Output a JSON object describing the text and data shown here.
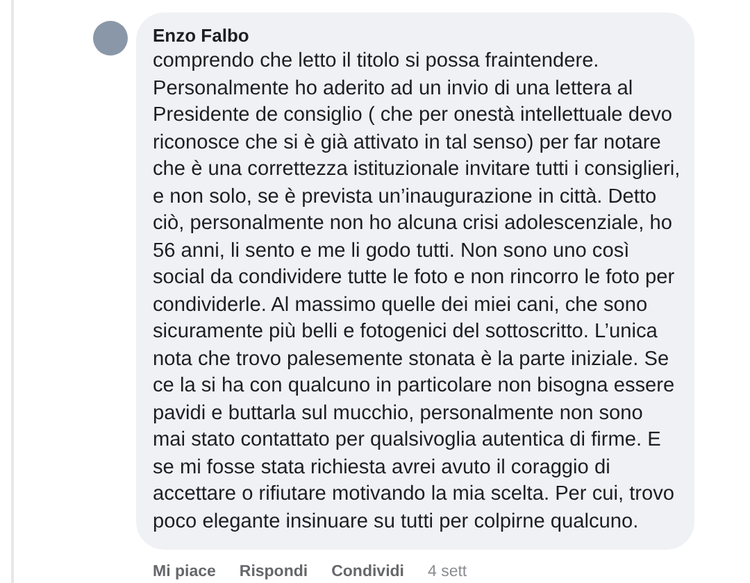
{
  "comment": {
    "author": "Enzo Falbo",
    "text": "comprendo che letto il titolo si possa fraintendere. Personalmente ho aderito ad un invio di una lettera al Presidente de consiglio ( che per onestà intellettuale devo riconosce che si è già attivato in tal senso) per far notare che è una correttezza istituzionale invitare tutti i consiglieri, e non solo, se è prevista un’inaugurazione in città. Detto ciò, personalmente non ho alcuna crisi adolescenziale, ho 56 anni, li sento e me li godo tutti. Non sono uno così social da condividere tutte le foto e non rincorro le foto per condividerle. Al massimo quelle dei miei cani, che sono sicuramente più belli e fotogenici del sottoscritto. L’unica nota che trovo palesemente stonata è la parte iniziale. Se ce la si ha con qualcuno in particolare non bisogna essere pavidi e buttarla sul mucchio, personalmente non sono mai stato contattato per qualsivoglia autentica di firme. E se mi fosse stata richiesta avrei avuto il coraggio di accettare o rifiutare motivando la mia scelta. Per cui, trovo poco elegante insinuare su tutti per colpirne qualcuno.",
    "actions": [
      "Mi piace",
      "Rispondi",
      "Condividi"
    ],
    "time": "4 sett"
  }
}
